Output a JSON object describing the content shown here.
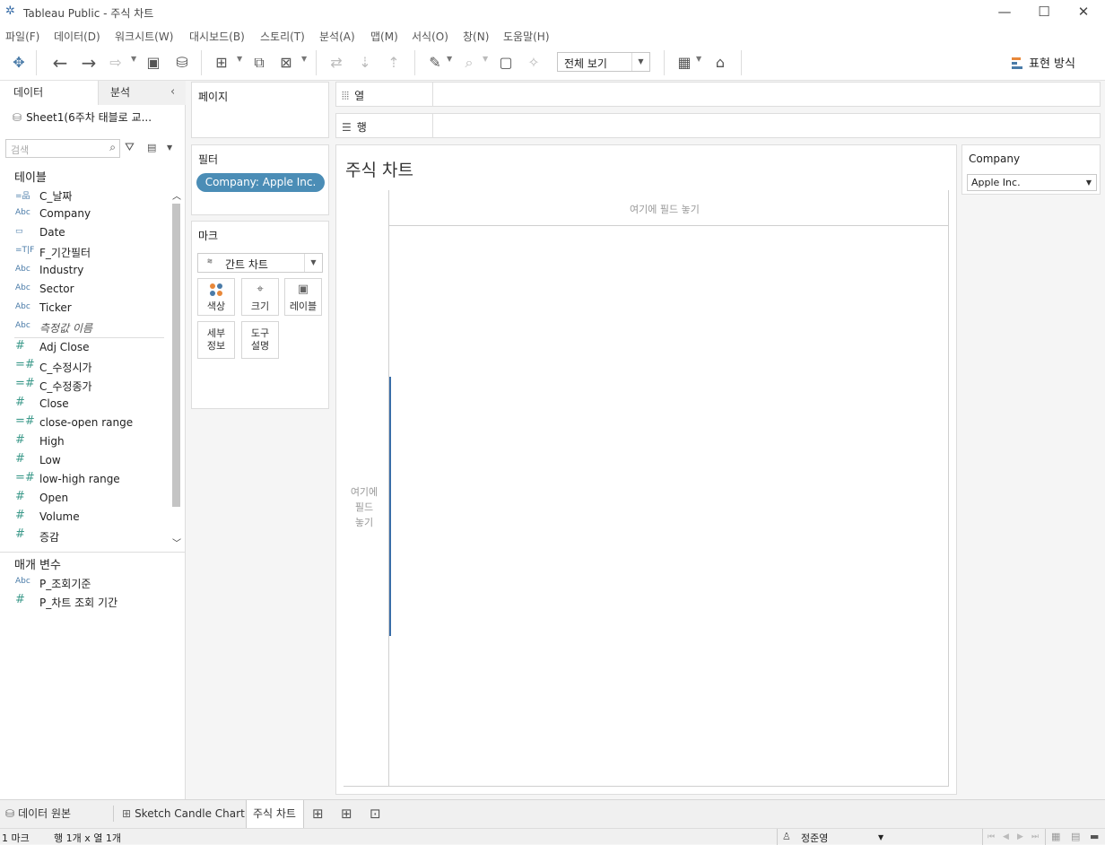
{
  "window": {
    "title": "Tableau Public - 주식 차트"
  },
  "menu": [
    "파일(F)",
    "데이터(D)",
    "워크시트(W)",
    "대시보드(B)",
    "스토리(T)",
    "분석(A)",
    "맵(M)",
    "서식(O)",
    "창(N)",
    "도움말(H)"
  ],
  "toolbar": {
    "view_mode": "전체 보기",
    "show_me": "표현 방식"
  },
  "data_pane": {
    "tab_data": "데이터",
    "tab_analysis": "분석",
    "datasource": "Sheet1(6주차 태블로 교...",
    "search_placeholder": "검색",
    "tables_header": "테이블",
    "dimensions": [
      {
        "icon": "calc-date-icon",
        "glyph": "=品",
        "name": "C_날짜"
      },
      {
        "icon": "string-icon",
        "glyph": "Abc",
        "name": "Company"
      },
      {
        "icon": "date-icon",
        "glyph": "▭",
        "name": "Date"
      },
      {
        "icon": "calc-bool-icon",
        "glyph": "=T|F",
        "name": "F_기간필터"
      },
      {
        "icon": "string-icon",
        "glyph": "Abc",
        "name": "Industry"
      },
      {
        "icon": "string-icon",
        "glyph": "Abc",
        "name": "Sector"
      },
      {
        "icon": "string-icon",
        "glyph": "Abc",
        "name": "Ticker"
      },
      {
        "icon": "string-icon",
        "glyph": "Abc",
        "name": "측정값 이름"
      }
    ],
    "measures": [
      {
        "icon": "number-icon",
        "glyph": "#",
        "name": "Adj Close"
      },
      {
        "icon": "calc-number-icon",
        "glyph": "=#",
        "name": "C_수정시가"
      },
      {
        "icon": "calc-number-icon",
        "glyph": "=#",
        "name": "C_수정종가"
      },
      {
        "icon": "number-icon",
        "glyph": "#",
        "name": "Close"
      },
      {
        "icon": "calc-number-icon",
        "glyph": "=#",
        "name": "close-open range"
      },
      {
        "icon": "number-icon",
        "glyph": "#",
        "name": "High"
      },
      {
        "icon": "number-icon",
        "glyph": "#",
        "name": "Low"
      },
      {
        "icon": "calc-number-icon",
        "glyph": "=#",
        "name": "low-high range"
      },
      {
        "icon": "number-icon",
        "glyph": "#",
        "name": "Open"
      },
      {
        "icon": "number-icon",
        "glyph": "#",
        "name": "Volume"
      },
      {
        "icon": "number-icon",
        "glyph": "#",
        "name": "증감"
      }
    ],
    "parameters_header": "매개 변수",
    "parameters": [
      {
        "icon": "string-icon",
        "glyph": "Abc",
        "name": "P_조회기준"
      },
      {
        "icon": "number-icon",
        "glyph": "#",
        "name": "P_차트 조회 기간"
      }
    ]
  },
  "cards": {
    "pages": "페이지",
    "filters": "필터",
    "filter_pill": "Company: Apple Inc.",
    "marks": "마크",
    "mark_type": "간트 차트",
    "mark_buttons": {
      "color": "색상",
      "size": "크기",
      "label": "레이블",
      "detail": "세부\n정보",
      "tooltip": "도구\n설명"
    }
  },
  "shelves": {
    "columns": "열",
    "rows": "행"
  },
  "view": {
    "title": "주식 차트",
    "drop_columns": "여기에 필드 놓기",
    "drop_rows": "여기에\n필드\n놓기"
  },
  "legend": {
    "title": "Company",
    "value": "Apple Inc."
  },
  "sheet_tabs": {
    "datasource": "데이터 원본",
    "sheet1": "Sketch Candle Chart",
    "sheet2": "주식 차트"
  },
  "status": {
    "marks": "1 마크",
    "rows_cols": "행 1개 x 열 1개",
    "user": "정준영"
  },
  "colors": {
    "accent": "#4b8db6",
    "measure": "#3d9a8b",
    "dimension": "#4a7ba8"
  }
}
